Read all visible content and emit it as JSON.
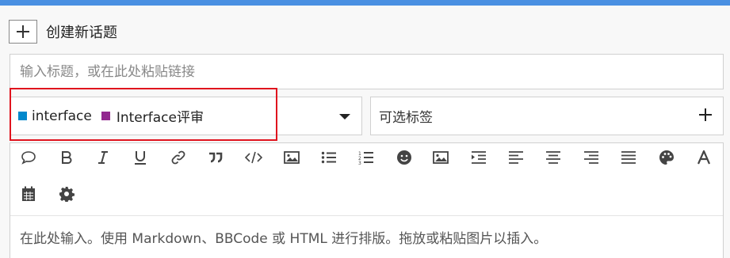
{
  "header": {
    "add_icon": "plus-icon",
    "title": "创建新话题"
  },
  "title_input": {
    "placeholder": "输入标题，或在此处粘贴链接",
    "value": ""
  },
  "category": {
    "items": [
      {
        "label": "interface",
        "color": "#0088cc"
      },
      {
        "label": "Interface评审",
        "color": "#92278f"
      }
    ],
    "dropdown_icon": "caret-down-icon"
  },
  "tags": {
    "placeholder": "可选标签",
    "add_icon": "plus-icon"
  },
  "highlight_color": "#e0141e",
  "toolbar": {
    "row1": [
      "quote-bubble-icon",
      "bold-icon",
      "italic-icon",
      "underline-icon",
      "link-icon",
      "blockquote-icon",
      "code-icon",
      "image-icon",
      "bullet-list-icon",
      "numbered-list-icon",
      "emoji-icon",
      "upload-image-icon",
      "indent-icon",
      "align-left-icon",
      "align-center-icon",
      "align-right-icon",
      "align-justify-icon",
      "palette-icon",
      "font-icon"
    ],
    "row2": [
      "calendar-icon",
      "gear-icon"
    ]
  },
  "editor": {
    "placeholder": "在此处输入。使用 Markdown、BBCode 或 HTML 进行排版。拖放或粘贴图片以插入。"
  }
}
